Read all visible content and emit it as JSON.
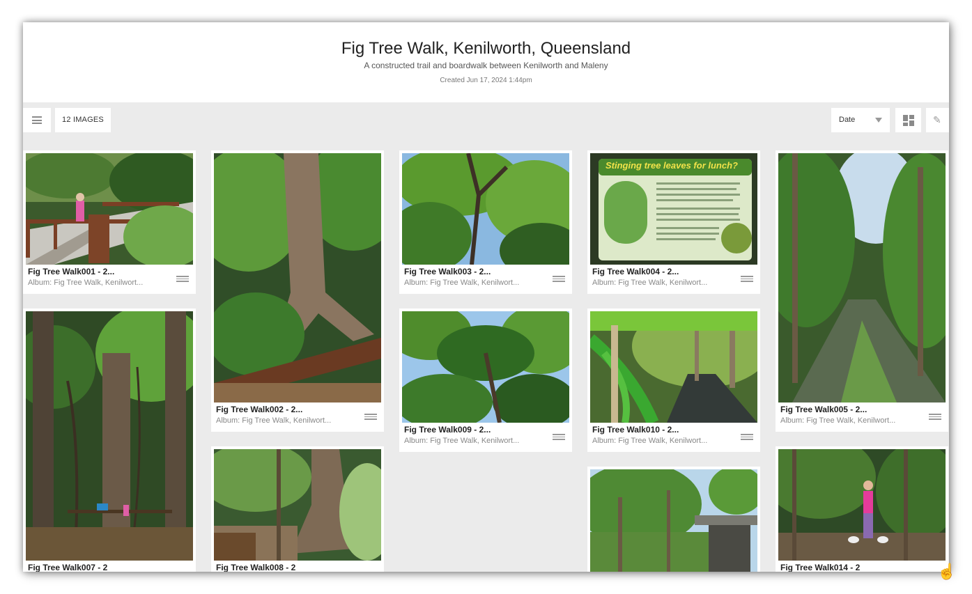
{
  "album": {
    "title": "Fig Tree Walk, Kenilworth, Queensland",
    "subtitle": "A constructed trail and boardwalk between Kenilworth and Maleny",
    "created": "Created Jun 17, 2024 1:44pm"
  },
  "toolbar": {
    "count_label": "12 IMAGES",
    "sort_value": "Date"
  },
  "cards": [
    {
      "title": "Fig Tree Walk001 - 2...",
      "album": "Album: Fig Tree Walk, Kenilwort..."
    },
    {
      "title": "Fig Tree Walk002 - 2...",
      "album": "Album: Fig Tree Walk, Kenilwort..."
    },
    {
      "title": "Fig Tree Walk003 - 2...",
      "album": "Album: Fig Tree Walk, Kenilwort..."
    },
    {
      "title": "Fig Tree Walk004 - 2...",
      "album": "Album: Fig Tree Walk, Kenilwort..."
    },
    {
      "title": "Fig Tree Walk005 - 2...",
      "album": "Album: Fig Tree Walk, Kenilwort..."
    },
    {
      "title": "Fig Tree Walk007 - 2"
    },
    {
      "title": "Fig Tree Walk008 - 2"
    },
    {
      "title": "Fig Tree Walk009 - 2...",
      "album": "Album: Fig Tree Walk, Kenilwort..."
    },
    {
      "title": "Fig Tree Walk010 - 2...",
      "album": "Album: Fig Tree Walk, Kenilwort..."
    },
    {
      "title": "Fig Tree Walk014 - 2"
    }
  ],
  "sign_text": "Stinging tree leaves for lunch?",
  "icons": [
    "list-menu-icon",
    "caret-down-icon",
    "layout-grid-icon",
    "pencil-icon",
    "item-menu-icon",
    "hand-cursor-icon"
  ],
  "colors": {
    "background": "#ebebeb",
    "card": "#ffffff",
    "cursor": "#d3148b"
  }
}
